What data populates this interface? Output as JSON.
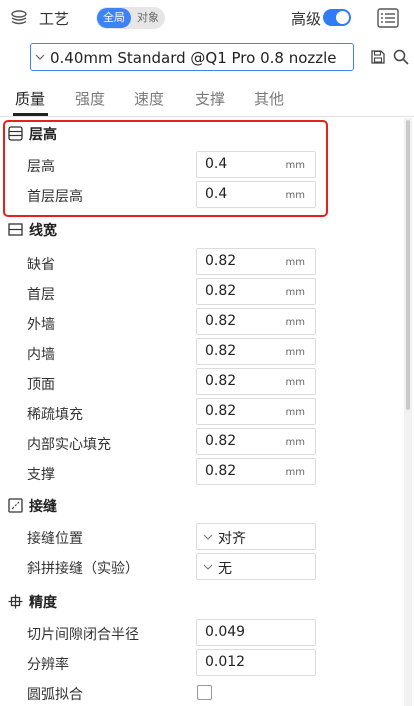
{
  "header": {
    "title": "工艺",
    "scope_global": "全局",
    "scope_object": "对象",
    "advanced_label": "高级",
    "advanced_enabled": true
  },
  "profile": {
    "selected": "0.40mm Standard @Q1 Pro 0.8 nozzle"
  },
  "tabs": [
    "质量",
    "强度",
    "速度",
    "支撑",
    "其他"
  ],
  "active_tab": "质量",
  "sections": {
    "layer_height": {
      "title": "层高",
      "rows": [
        {
          "label": "层高",
          "value": "0.4",
          "unit": "mm"
        },
        {
          "label": "首层层高",
          "value": "0.4",
          "unit": "mm"
        }
      ]
    },
    "line_width": {
      "title": "线宽",
      "rows": [
        {
          "label": "缺省",
          "value": "0.82",
          "unit": "mm"
        },
        {
          "label": "首层",
          "value": "0.82",
          "unit": "mm"
        },
        {
          "label": "外墙",
          "value": "0.82",
          "unit": "mm"
        },
        {
          "label": "内墙",
          "value": "0.82",
          "unit": "mm"
        },
        {
          "label": "顶面",
          "value": "0.82",
          "unit": "mm"
        },
        {
          "label": "稀疏填充",
          "value": "0.82",
          "unit": "mm"
        },
        {
          "label": "内部实心填充",
          "value": "0.82",
          "unit": "mm"
        },
        {
          "label": "支撑",
          "value": "0.82",
          "unit": "mm"
        }
      ]
    },
    "seam": {
      "title": "接缝",
      "rows": [
        {
          "label": "接缝位置",
          "value": "对齐"
        },
        {
          "label": "斜拼接缝（实验）",
          "value": "无"
        }
      ]
    },
    "precision": {
      "title": "精度",
      "rows": [
        {
          "label": "切片间隙闭合半径",
          "value": "0.049"
        },
        {
          "label": "分辨率",
          "value": "0.012"
        },
        {
          "label": "圆弧拟合",
          "checked": false
        }
      ]
    }
  },
  "colors": {
    "accent": "#3c83f6",
    "highlight": "#e5201d"
  }
}
